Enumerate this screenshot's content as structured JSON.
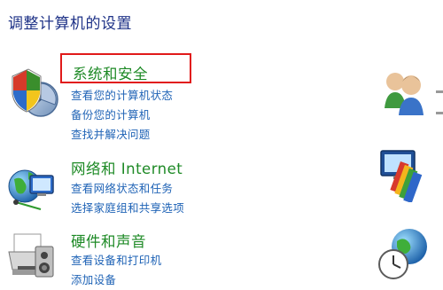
{
  "page": {
    "title": "调整计算机的设置"
  },
  "categories": [
    {
      "title": "系统和安全",
      "links": [
        "查看您的计算机状态",
        "备份您的计算机",
        "查找并解决问题"
      ],
      "icon": "shield-security-icon"
    },
    {
      "title": "网络和 Internet",
      "links": [
        "查看网络状态和任务",
        "选择家庭组和共享选项"
      ],
      "icon": "network-globe-icon"
    },
    {
      "title": "硬件和声音",
      "links": [
        "查看设备和打印机",
        "添加设备"
      ],
      "icon": "printer-icon"
    }
  ],
  "right_column": [
    {
      "icon": "user-accounts-icon"
    },
    {
      "icon": "appearance-palette-icon"
    },
    {
      "icon": "clock-globe-icon"
    }
  ],
  "colors": {
    "title": "#1e3287",
    "category_title": "#1e8a26",
    "link": "#1f63b6",
    "highlight": "#e11a1a"
  }
}
